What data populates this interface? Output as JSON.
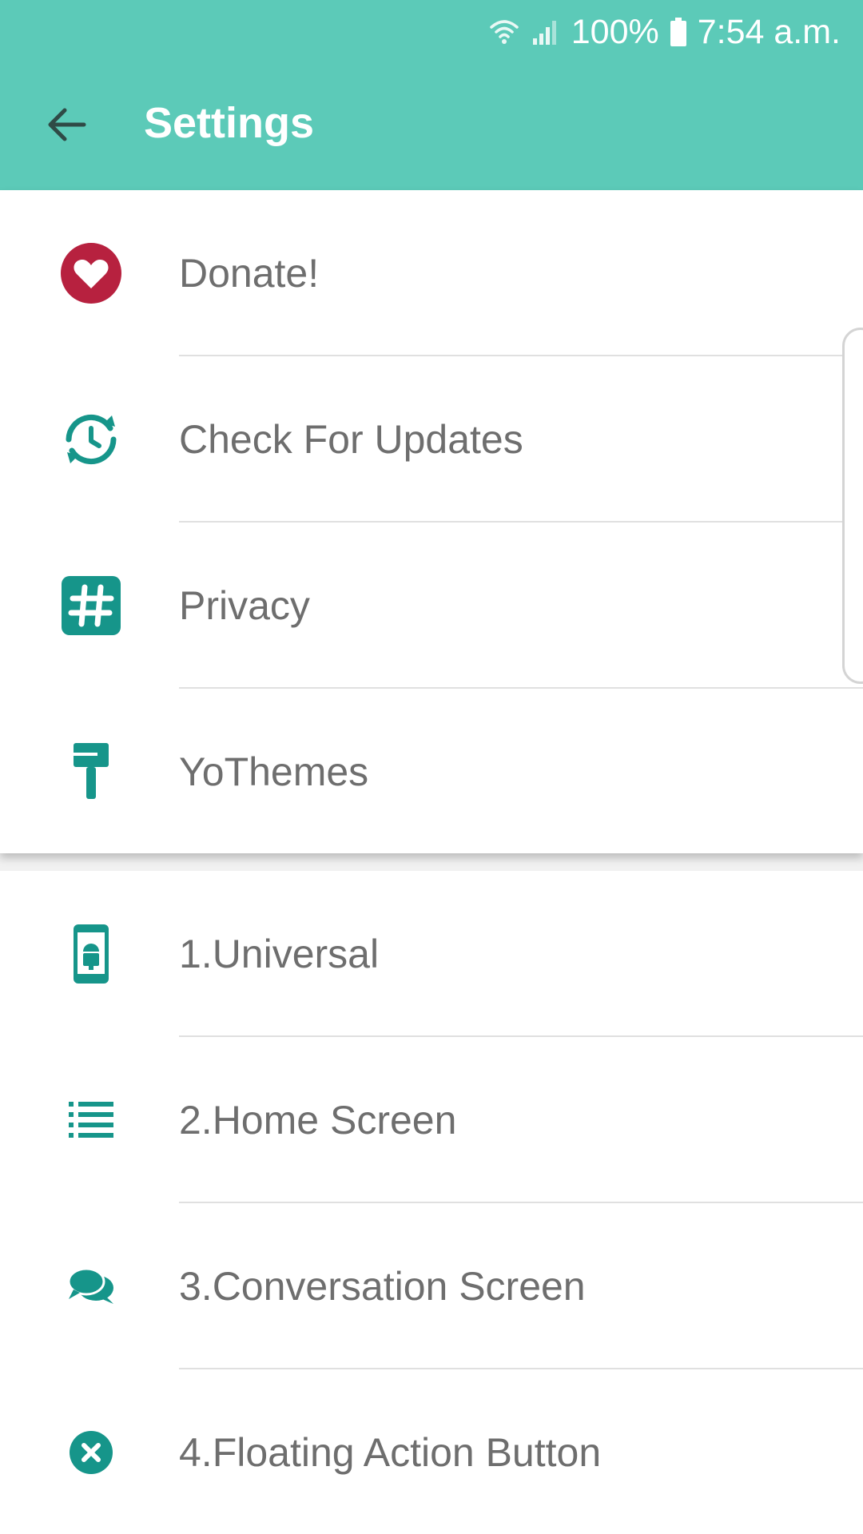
{
  "status_bar": {
    "battery": "100%",
    "time": "7:54 a.m.",
    "icons": [
      "wifi-icon",
      "signal-icon",
      "battery-icon"
    ]
  },
  "app_bar": {
    "title": "Settings",
    "back_icon": "arrow-back-icon",
    "background_color": "#5ccab8"
  },
  "general_items": [
    {
      "label": "Donate!",
      "icon": "heart-icon",
      "icon_color": "#b7213f"
    },
    {
      "label": "Check For Updates",
      "icon": "update-clock-icon",
      "icon_color": "#16958a"
    },
    {
      "label": "Privacy",
      "icon": "hashtag-icon",
      "icon_color": "#16958a"
    },
    {
      "label": "YoThemes",
      "icon": "paint-roller-icon",
      "icon_color": "#16958a"
    }
  ],
  "category_items": [
    {
      "label": "1.Universal",
      "icon": "android-phone-icon",
      "icon_color": "#16958a"
    },
    {
      "label": "2.Home Screen",
      "icon": "list-icon",
      "icon_color": "#16958a"
    },
    {
      "label": "3.Conversation Screen",
      "icon": "chat-bubbles-icon",
      "icon_color": "#16958a"
    },
    {
      "label": "4.Floating Action Button",
      "icon": "close-circle-icon",
      "icon_color": "#16958a"
    }
  ]
}
